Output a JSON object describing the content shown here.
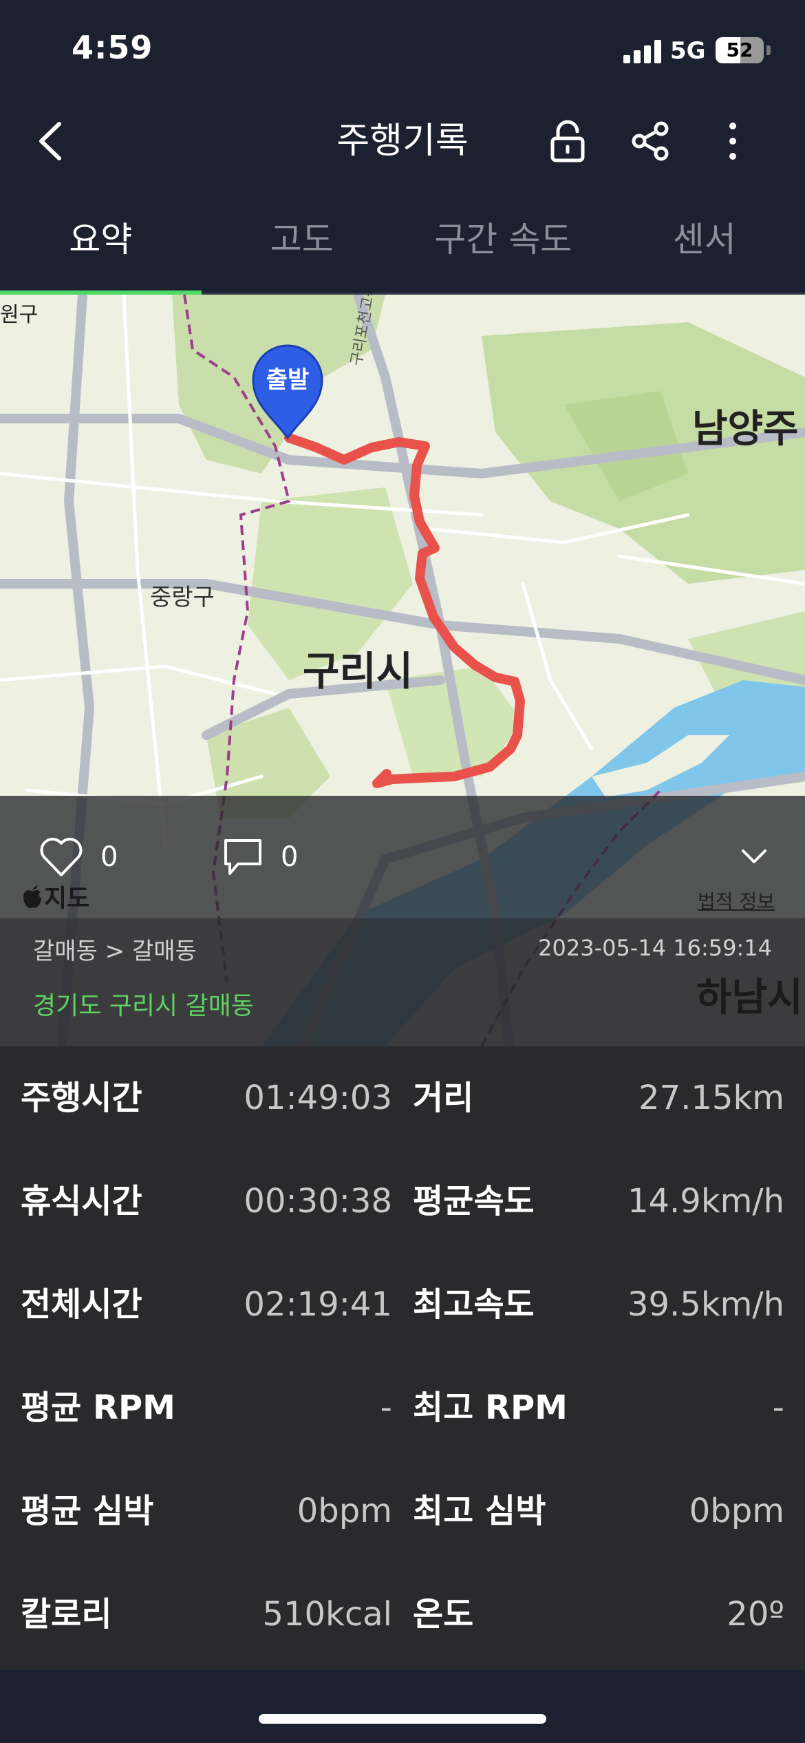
{
  "status_bar": {
    "time": "4:59",
    "network": "5G",
    "battery": "52",
    "battery_level": 0.52
  },
  "header": {
    "title": "주행기록",
    "icons": [
      "back-icon",
      "unlock-icon",
      "share-icon",
      "more-vertical-icon"
    ]
  },
  "tabs": [
    {
      "label": "요약",
      "active": true
    },
    {
      "label": "고도",
      "active": false
    },
    {
      "label": "구간 속도",
      "active": false
    },
    {
      "label": "센서",
      "active": false
    }
  ],
  "map": {
    "start_marker": "출발",
    "labels": {
      "top_left": "원구",
      "jungnang": "중랑구",
      "guri": "구리시",
      "namyang": "남양주",
      "hanam": "하남시",
      "road": "구리포천고속"
    },
    "provider": "지도",
    "legal": "법적 정보",
    "route_color": "#e8524a"
  },
  "social": {
    "likes": "0",
    "comments": "0"
  },
  "ride": {
    "route": "갈매동 > 갈매동",
    "date": "2023-05-14 16:59:14",
    "location": "경기도 구리시 갈매동"
  },
  "stats": [
    {
      "label": "주행시간",
      "value": "01:49:03",
      "label2": "거리",
      "value2": "27.15km"
    },
    {
      "label": "휴식시간",
      "value": "00:30:38",
      "label2": "평균속도",
      "value2": "14.9km/h"
    },
    {
      "label": "전체시간",
      "value": "02:19:41",
      "label2": "최고속도",
      "value2": "39.5km/h"
    },
    {
      "label": "평균 RPM",
      "value": "-",
      "label2": "최고 RPM",
      "value2": "-"
    },
    {
      "label": "평균 심박",
      "value": "0bpm",
      "label2": "최고 심박",
      "value2": "0bpm"
    },
    {
      "label": "칼로리",
      "value": "510kcal",
      "label2": "온도",
      "value2": "20º"
    }
  ],
  "colors": {
    "header_bg": "#1c2130",
    "accent": "#4cd964",
    "route": "#e8524a",
    "location_text": "#5fd35f",
    "marker": "#2f5ee6"
  }
}
